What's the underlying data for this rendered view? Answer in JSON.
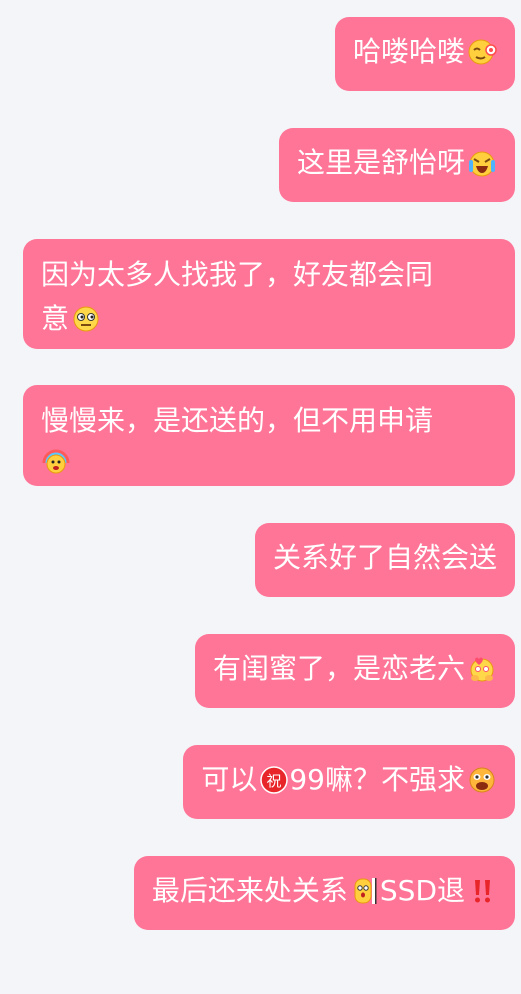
{
  "messages": [
    {
      "text": "哈喽哈喽",
      "icon": "blushing-smile-emoji"
    },
    {
      "text": "这里是舒怡呀",
      "icon": "laughing-crying-emoji"
    },
    {
      "line1": "因为太多人找我了，好友都会同",
      "line2": "意",
      "icon": "skeptical-face-emoji"
    },
    {
      "line1": "慢慢来，是还送的，但不用申请",
      "icon": "rainbow-party-emoji"
    },
    {
      "text": "关系好了自然会送"
    },
    {
      "text": "有闺蜜了，是恋老六",
      "icon": "love-hug-emoji"
    },
    {
      "text_a": "可以",
      "text_b": "99嘛？不强求",
      "icon_a": "blessing-badge-icon",
      "badge": "祝",
      "icon": "pleading-dog-emoji"
    },
    {
      "text_a": "最后还来处关系",
      "text_b": "SSD退",
      "icon_a": "peeking-emoji",
      "icon": "double-exclamation-icon"
    }
  ],
  "colors": {
    "background": "#f4f5f9",
    "bubble": "#ff7597",
    "bubble_text": "#ffffff"
  }
}
